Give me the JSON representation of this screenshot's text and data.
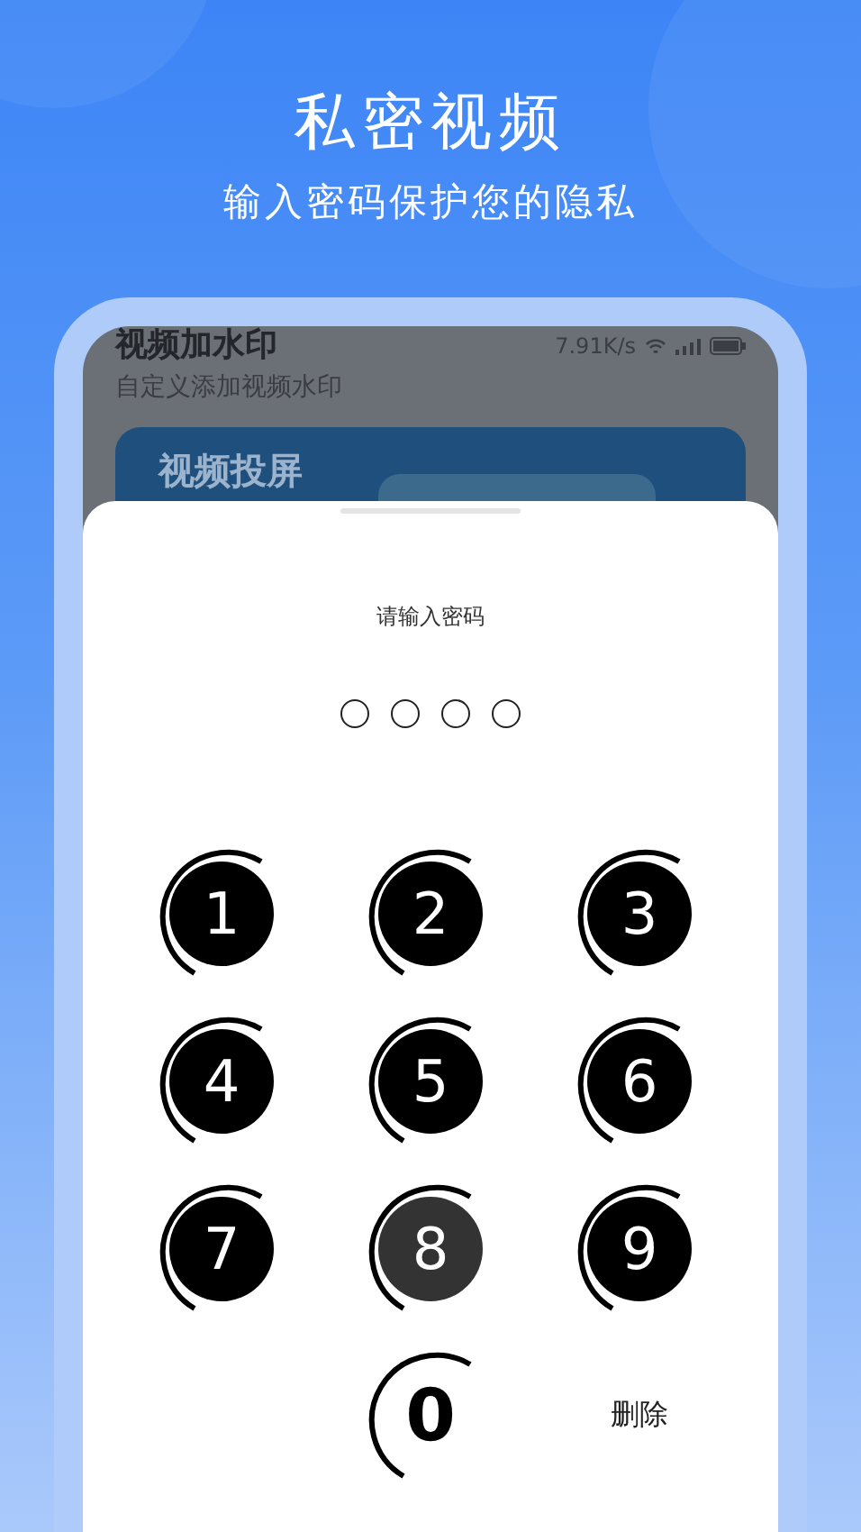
{
  "header": {
    "title": "私密视频",
    "subtitle": "输入密码保护您的隐私"
  },
  "background_app": {
    "title": "视频加水印",
    "net_speed": "7.91K/s",
    "subtitle": "自定义添加视频水印",
    "card_title": "视频投屏"
  },
  "password_sheet": {
    "prompt": "请输入密码",
    "dots": [
      {
        "filled": false
      },
      {
        "filled": false
      },
      {
        "filled": false
      },
      {
        "filled": false
      }
    ],
    "keys": [
      {
        "kind": "filled",
        "label": "1",
        "pressed": false
      },
      {
        "kind": "filled",
        "label": "2",
        "pressed": false
      },
      {
        "kind": "filled",
        "label": "3",
        "pressed": false
      },
      {
        "kind": "filled",
        "label": "4",
        "pressed": false
      },
      {
        "kind": "filled",
        "label": "5",
        "pressed": false
      },
      {
        "kind": "filled",
        "label": "6",
        "pressed": false
      },
      {
        "kind": "filled",
        "label": "7",
        "pressed": false
      },
      {
        "kind": "filled",
        "label": "8",
        "pressed": true
      },
      {
        "kind": "filled",
        "label": "9",
        "pressed": false
      },
      {
        "kind": "outline",
        "label": "0",
        "pressed": false
      },
      {
        "kind": "text",
        "label": "删除",
        "pressed": false
      }
    ]
  }
}
